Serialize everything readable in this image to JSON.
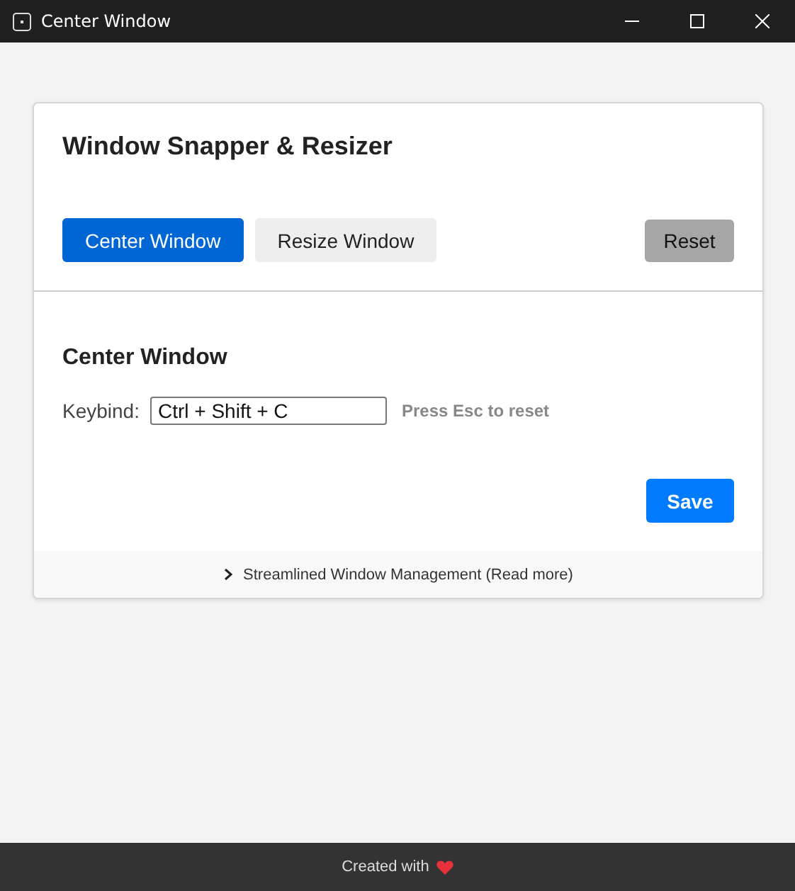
{
  "window": {
    "title": "Center Window"
  },
  "card": {
    "title": "Window Snapper & Resizer",
    "tabs": [
      {
        "label": "Center Window",
        "selected": true
      },
      {
        "label": "Resize Window",
        "selected": false
      }
    ],
    "reset_button": "Reset",
    "section": {
      "title": "Center Window",
      "keybind_label": "Keybind:",
      "keybind_value": "Ctrl + Shift + C",
      "hint": "Press Esc to reset",
      "save_button": "Save"
    },
    "details": {
      "summary": "Streamlined Window Management (Read more)",
      "expanded": false
    }
  },
  "footer": {
    "text": "Created with"
  }
}
